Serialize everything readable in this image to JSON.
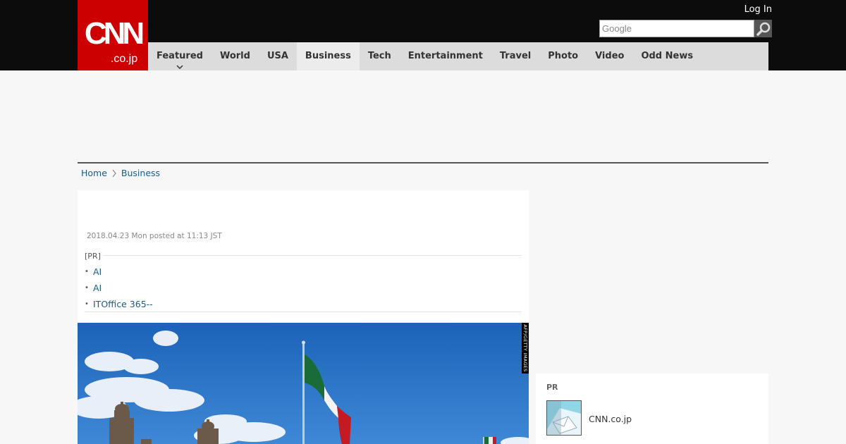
{
  "header": {
    "logo_text": "CNN.co.jp",
    "login_label": "Log In",
    "search_placeholder": "Google",
    "nav": [
      {
        "label": "Featured"
      },
      {
        "label": "World"
      },
      {
        "label": "USA"
      },
      {
        "label": "Business",
        "active": true
      },
      {
        "label": "Tech"
      },
      {
        "label": "Entertainment"
      },
      {
        "label": "Travel"
      },
      {
        "label": "Photo"
      },
      {
        "label": "Video"
      },
      {
        "label": "Odd News"
      }
    ]
  },
  "breadcrumb": {
    "home": "Home",
    "section": "Business"
  },
  "article": {
    "posted": "2018.04.23 Mon posted at 11:13 JST",
    "pr_tag": "[PR]",
    "pr_links": [
      "AI",
      "AI",
      "ITOffice 365--"
    ],
    "photo_credit": "AFP/GETTY IMAGES"
  },
  "sidebar": {
    "pr_label": "PR",
    "pr_link": "CNN.co.jp"
  },
  "colors": {
    "brand_red": "#cc0000",
    "header_bg": "#0c0c0c",
    "nav_bg": "#dcdcdc",
    "link": "#1a5a8a"
  }
}
